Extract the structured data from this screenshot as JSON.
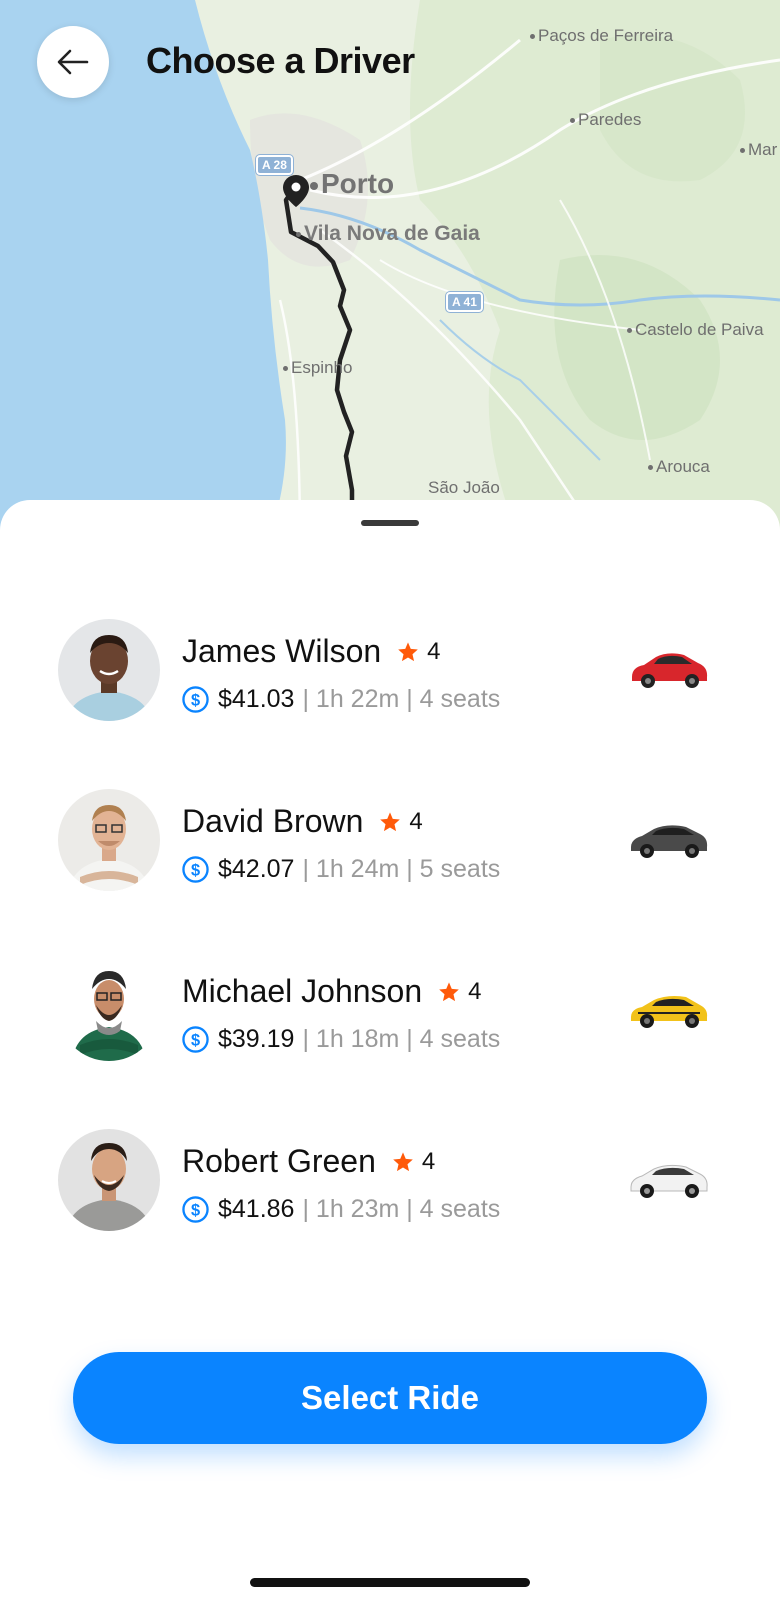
{
  "header": {
    "title": "Choose a Driver"
  },
  "map": {
    "labels": {
      "pacos": "Paços de Ferreira",
      "paredes": "Paredes",
      "mar": "Mar",
      "porto": "Porto",
      "gaia": "Vila Nova de Gaia",
      "espinho": "Espinho",
      "castelo": "Castelo de Paiva",
      "arouca": "Arouca",
      "sao_joao": "São João"
    },
    "shields": {
      "a28": "A 28",
      "a41": "A 41"
    },
    "colors": {
      "sea": "#a9d3f0",
      "land": "#e8efdf",
      "route": "#222222"
    }
  },
  "drivers": [
    {
      "name": "James Wilson",
      "rating": "4",
      "price": "$41.03",
      "details": "| 1h 22m | 4 seats",
      "car_color": "#d8262c"
    },
    {
      "name": "David Brown",
      "rating": "4",
      "price": "$42.07",
      "details": "| 1h 24m | 5 seats",
      "car_color": "#4a4a4a"
    },
    {
      "name": "Michael Johnson",
      "rating": "4",
      "price": "$39.19",
      "details": "| 1h 18m | 4 seats",
      "car_color": "#f2c21a"
    },
    {
      "name": "Robert Green",
      "rating": "4",
      "price": "$41.86",
      "details": "| 1h 23m | 4 seats",
      "car_color": "#f2f2f2"
    }
  ],
  "actions": {
    "select_label": "Select Ride"
  },
  "colors": {
    "accent": "#0a84ff",
    "star": "#ff5a0a"
  },
  "icons": {
    "back": "arrow-left-icon",
    "star": "star-icon",
    "coin": "dollar-coin-icon",
    "car": "car-icon",
    "pin": "location-pin-icon"
  }
}
